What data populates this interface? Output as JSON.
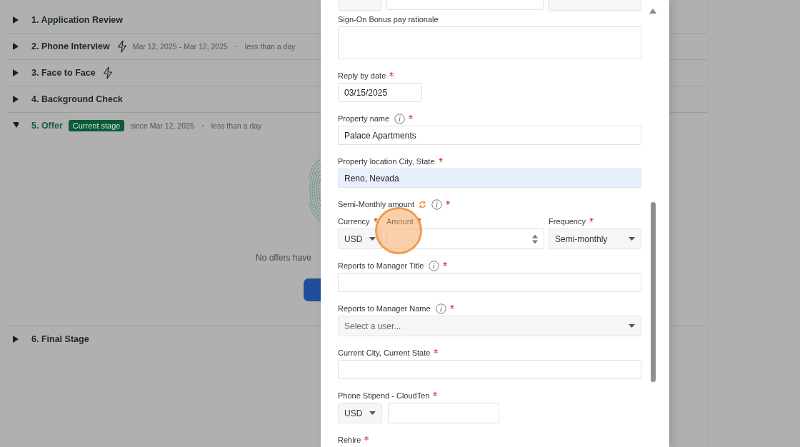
{
  "stages": [
    {
      "title": "1. Application Review",
      "expanded": false,
      "lightning": false
    },
    {
      "title": "2. Phone Interview",
      "expanded": false,
      "lightning": true,
      "dates": "Mar 12, 2025 - Mar 12, 2025",
      "duration": "less than a day"
    },
    {
      "title": "3. Face to Face",
      "expanded": false,
      "lightning": true
    },
    {
      "title": "4. Background Check",
      "expanded": false,
      "lightning": false
    },
    {
      "title": "5. Offer",
      "expanded": true,
      "lightning": false,
      "badge": "Current stage",
      "dates": "since Mar 12, 2025",
      "duration": "less than a day",
      "empty_message": "No offers have"
    },
    {
      "title": "6. Final Stage",
      "expanded": false,
      "lightning": false
    }
  ],
  "form": {
    "cut_off_fields": [
      {
        "kind": "select"
      },
      {
        "kind": "input"
      },
      {
        "kind": "select"
      }
    ],
    "fields": [
      {
        "kind": "textarea",
        "label": "Sign-On Bonus pay rationale",
        "required": false,
        "info": false
      },
      {
        "kind": "date",
        "label": "Reply by date",
        "required": true,
        "info": false,
        "value": "03/15/2025"
      },
      {
        "kind": "text",
        "label": "Property name",
        "required": true,
        "info": true,
        "value": "Palace Apartments",
        "autofilled": false
      },
      {
        "kind": "text",
        "label": "Property location City, State",
        "required": true,
        "info": false,
        "value": "Reno, Nevada",
        "autofilled": true
      },
      {
        "kind": "compensation",
        "label": "Semi-Monthly amount",
        "required": true,
        "info": true,
        "sync": true,
        "currency": {
          "label": "Currency",
          "required": true,
          "value": "USD"
        },
        "amount": {
          "label": "Amount",
          "required": true,
          "click_highlight": true
        },
        "frequency": {
          "label": "Frequency",
          "required": true,
          "value": "Semi-monthly"
        }
      },
      {
        "kind": "text",
        "label": "Reports to Manager Title",
        "required": true,
        "info": true,
        "autofilled": false
      },
      {
        "kind": "select",
        "label": "Reports to Manager Name",
        "required": true,
        "info": true,
        "placeholder": "Select a user..."
      },
      {
        "kind": "text",
        "label": "Current City, Current State",
        "required": true,
        "info": false,
        "autofilled": false
      },
      {
        "kind": "money",
        "label": "Phone Stipend - CloudTen",
        "required": true,
        "info": false,
        "currency": "USD"
      },
      {
        "kind": "label",
        "label": "Rehire",
        "required": true,
        "info": false
      }
    ]
  }
}
